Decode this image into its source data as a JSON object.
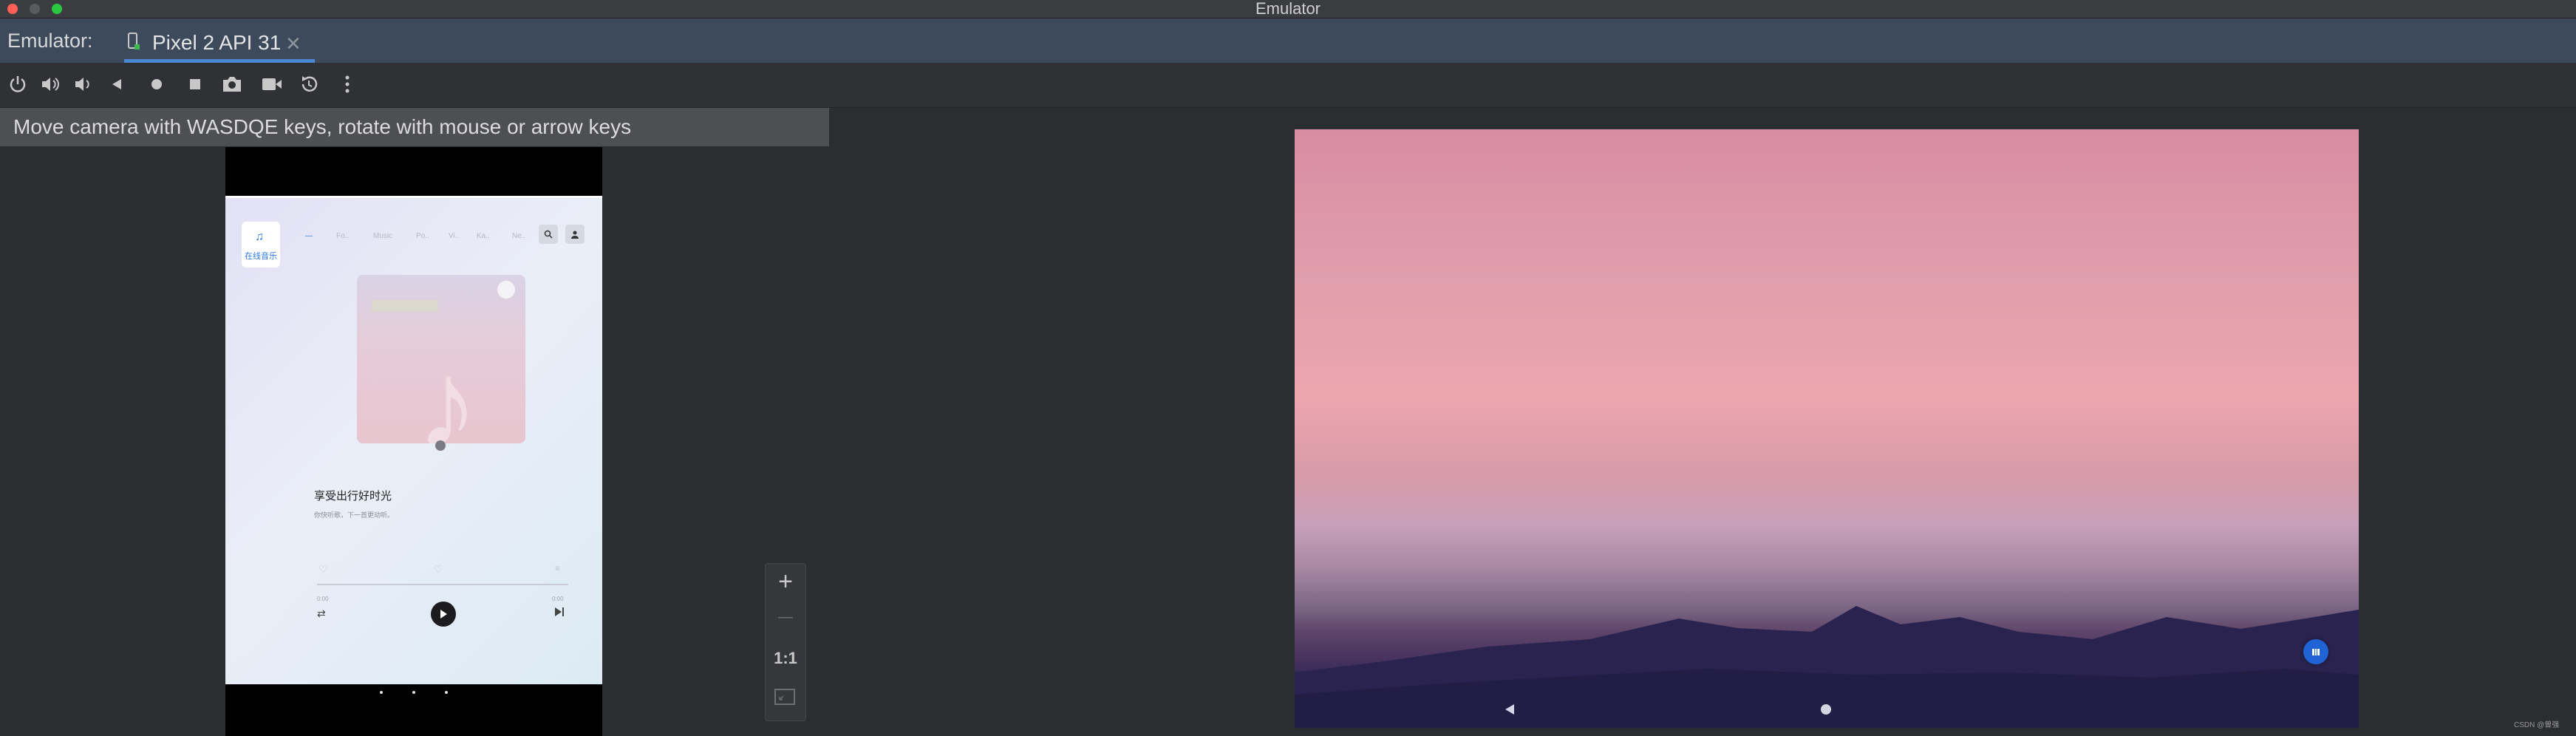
{
  "window": {
    "title": "Emulator",
    "traffic_lights": {
      "close": "#ff5f57",
      "minimize": "#5a5b5d",
      "zoom": "#28c840"
    }
  },
  "tool_window": {
    "label": "Emulator:"
  },
  "device_tab": {
    "label": "Pixel 2 API 31",
    "close_icon": "close-icon",
    "accent": "#4a88d6"
  },
  "toolbar": {
    "icons": [
      "power-icon",
      "volume-up-icon",
      "volume-down-icon",
      "back-icon",
      "home-icon",
      "overview-icon",
      "screenshot-icon",
      "record-icon",
      "rotate-icon",
      "more-icon"
    ]
  },
  "info_bar": {
    "text": "Move camera with WASDQE keys, rotate with mouse or arrow keys"
  },
  "music_app": {
    "logo_label": "在线音乐",
    "nav_tabs": [
      "—",
      "Fo..",
      "Music",
      "Po..",
      "Vi..",
      "Ka..",
      "Ne.."
    ],
    "song_title": "享受出行好时光",
    "song_subtitle": "你快听歌，下一首更动听。",
    "time_start": "0:00",
    "time_end": "0:00"
  },
  "zoom_controls": {
    "zoom_in": "+",
    "zoom_out": "—",
    "actual_size": "1:1"
  },
  "watermark": {
    "text": "CSDN @曾强"
  }
}
